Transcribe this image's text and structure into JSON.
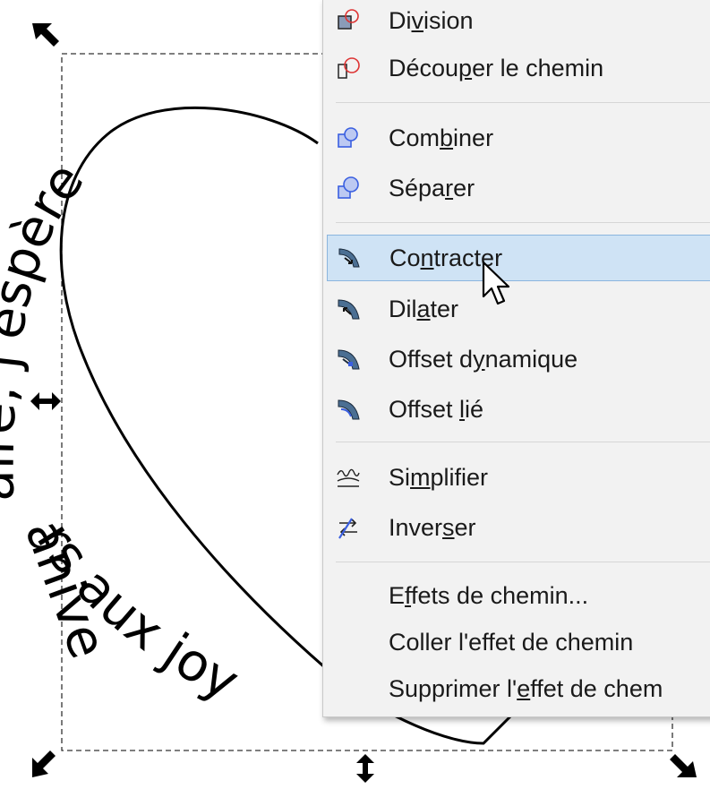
{
  "canvas": {
    "curved_text": "j'espère aniversaire joyeux"
  },
  "menu": {
    "items": [
      {
        "key": "division",
        "pre": "Di",
        "u": "v",
        "post": "ision",
        "icon": "path-division-icon"
      },
      {
        "key": "cut-path",
        "pre": "Décou",
        "u": "p",
        "post": "er le chemin",
        "icon": "path-cut-icon"
      },
      {
        "key": "combine",
        "pre": "Com",
        "u": "b",
        "post": "iner",
        "icon": "path-combine-icon"
      },
      {
        "key": "break-apart",
        "pre": "Sépa",
        "u": "r",
        "post": "er",
        "icon": "path-break-apart-icon"
      },
      {
        "key": "inset",
        "pre": "Co",
        "u": "n",
        "post": "tracter",
        "icon": "path-inset-icon"
      },
      {
        "key": "outset",
        "pre": "Dil",
        "u": "a",
        "post": "ter",
        "icon": "path-outset-icon"
      },
      {
        "key": "dynamic-offset",
        "pre": "Offset d",
        "u": "y",
        "post": "namique",
        "icon": "path-dynamic-offset-icon"
      },
      {
        "key": "linked-offset",
        "pre": "Offset ",
        "u": "l",
        "post": "ié",
        "icon": "path-linked-offset-icon"
      },
      {
        "key": "simplify",
        "pre": "Si",
        "u": "m",
        "post": "plifier",
        "icon": "path-simplify-icon"
      },
      {
        "key": "reverse",
        "pre": "Inver",
        "u": "s",
        "post": "er",
        "icon": "path-reverse-icon"
      },
      {
        "key": "path-effects",
        "pre": "E",
        "u": "f",
        "post": "fets de chemin...",
        "icon": ""
      },
      {
        "key": "paste-effect",
        "pre": "Coller l'effet de chemin",
        "u": "",
        "post": "",
        "icon": ""
      },
      {
        "key": "remove-effect",
        "pre": "Supprimer l'",
        "u": "e",
        "post": "ffet de chem",
        "icon": ""
      }
    ],
    "highlighted_key": "inset"
  },
  "colors": {
    "highlight_bg": "#cfe3f5",
    "highlight_border": "#8bb5de",
    "menu_bg": "#f2f2f2",
    "icon_blue": "#3a5fe0"
  }
}
